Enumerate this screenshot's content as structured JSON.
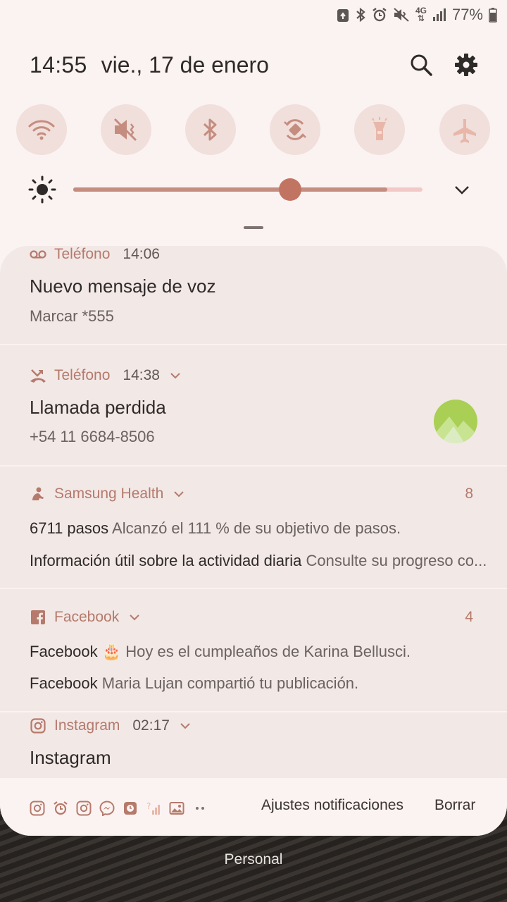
{
  "status": {
    "network": "4G",
    "battery": "77%"
  },
  "header": {
    "time": "14:55",
    "date": "vie., 17 de enero"
  },
  "toggles": [
    {
      "name": "wifi"
    },
    {
      "name": "mute"
    },
    {
      "name": "bluetooth"
    },
    {
      "name": "auto-rotate"
    },
    {
      "name": "flashlight"
    },
    {
      "name": "airplane"
    }
  ],
  "brightness": {
    "level": 0.62
  },
  "notifications": {
    "voicemail": {
      "app": "Teléfono",
      "time": "14:06",
      "title": "Nuevo mensaje de voz",
      "subtitle": "Marcar *555"
    },
    "missed_call": {
      "app": "Teléfono",
      "time": "14:38",
      "title": "Llamada perdida",
      "subtitle": "+54 11 6684-8506"
    },
    "health": {
      "app": "Samsung Health",
      "count": "8",
      "line1_bold": "6711 pasos",
      "line1_text": " Alcanzó el 111 % de su objetivo de pasos.",
      "line2_bold": "Información útil sobre la actividad diaria",
      "line2_text": " Consulte su progreso co..."
    },
    "facebook": {
      "app": "Facebook",
      "count": "4",
      "line1_bold": "Facebook",
      "line1_text": " 🎂 Hoy es el cumpleaños de Karina Bellusci.",
      "line2_bold": "Facebook",
      "line2_text": " Maria Lujan compartió tu publicación."
    },
    "instagram": {
      "app": "Instagram",
      "time": "02:17",
      "title": "Instagram"
    }
  },
  "bottom": {
    "settings_label": "Ajustes notificaciones",
    "clear_label": "Borrar"
  },
  "wallpaper": {
    "label": "Personal"
  },
  "colors": {
    "accent": "#c27462",
    "accent_text": "#b57a6c",
    "panel": "#f2e8e6",
    "toggle_bg": "#f0dfdb"
  }
}
